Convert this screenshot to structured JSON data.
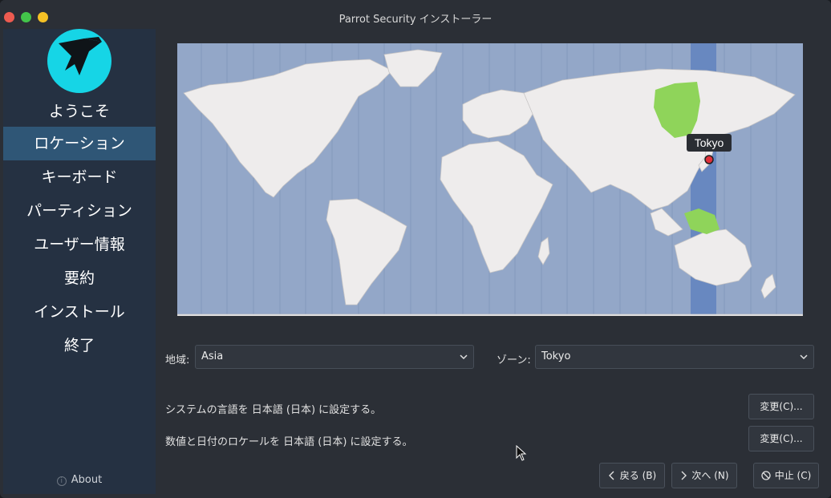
{
  "window": {
    "title": "Parrot Security インストーラー"
  },
  "sidebar": {
    "welcome": "ようこそ",
    "items": [
      {
        "label": "ロケーション",
        "active": true
      },
      {
        "label": "キーボード",
        "active": false
      },
      {
        "label": "パーティション",
        "active": false
      },
      {
        "label": "ユーザー情報",
        "active": false
      },
      {
        "label": "要約",
        "active": false
      },
      {
        "label": "インストール",
        "active": false
      },
      {
        "label": "終了",
        "active": false
      }
    ],
    "about_label": "About"
  },
  "map": {
    "selected_city": "Tokyo"
  },
  "location": {
    "region_label": "地域:",
    "region_value": "Asia",
    "zone_label": "ゾーン:",
    "zone_value": "Tokyo"
  },
  "settings": {
    "language_text": "システムの言語を 日本語 (日本) に設定する。",
    "language_button": "変更(C)...",
    "locale_text": "数値と日付のロケールを 日本語 (日本) に設定する。",
    "locale_button": "変更(C)..."
  },
  "footer": {
    "back_label": "戻る (B)",
    "next_label": "次へ (N)",
    "cancel_label": "中止 (C)"
  },
  "colors": {
    "accent": "#16d5e6",
    "sidebar": "#253142",
    "sidebar_active": "#2f5676",
    "map_ocean": "#93a7c8",
    "map_land": "#eeecec",
    "timezone_highlight": "#6888c0",
    "country_highlight": "#8fd45a"
  }
}
